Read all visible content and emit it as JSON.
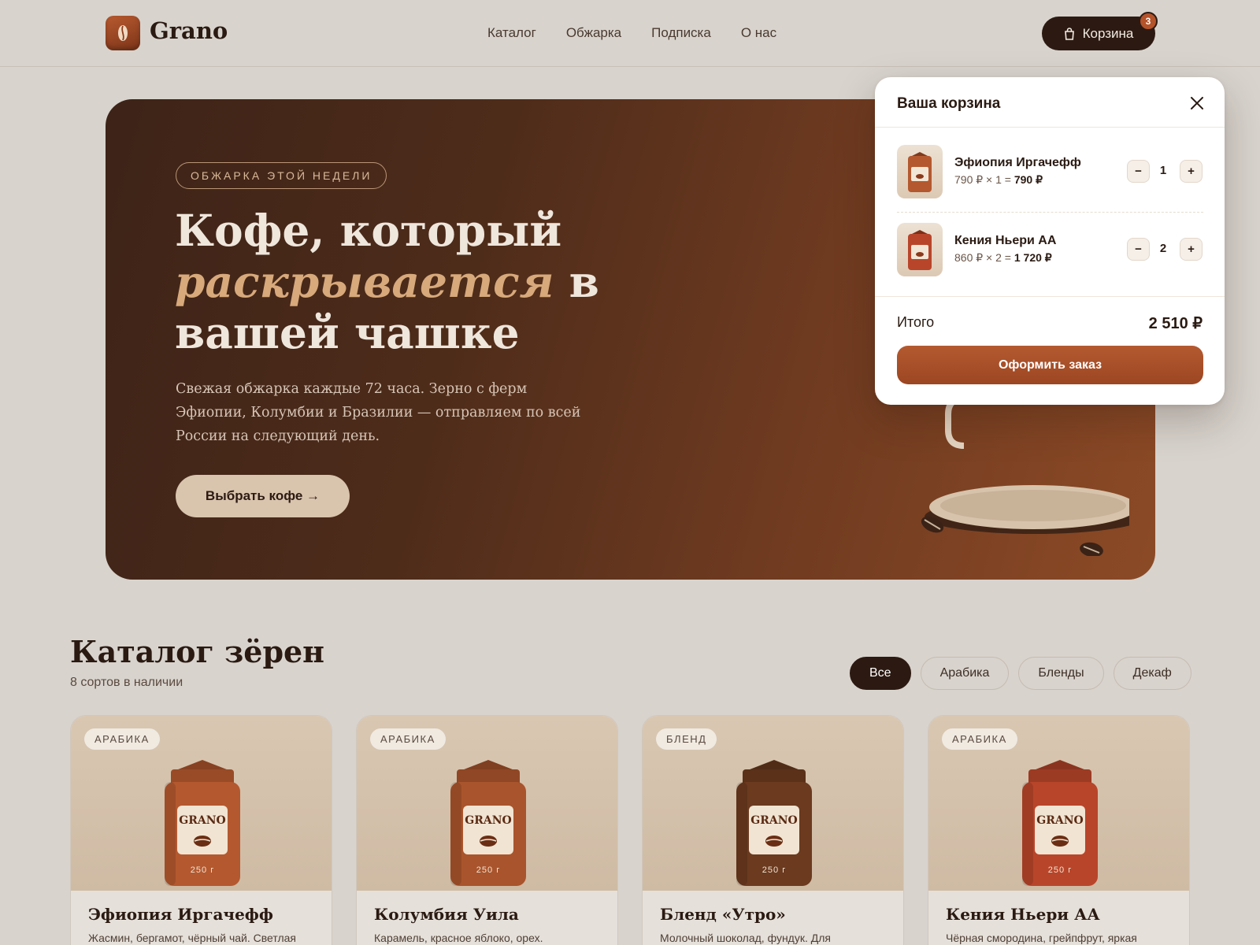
{
  "brand": {
    "name": "Grano"
  },
  "nav": {
    "items": [
      "Каталог",
      "Обжарка",
      "Подписка",
      "О нас"
    ]
  },
  "cart_button": {
    "label": "Корзина",
    "count": "3"
  },
  "hero": {
    "badge": "ОБЖАРКА ЭТОЙ НЕДЕЛИ",
    "title_line1": "Кофе, который",
    "title_accent": "раскрывается",
    "title_after_accent": " в",
    "title_line3": "вашей чашке",
    "description": "Свежая обжарка каждые 72 часа. Зерно с ферм Эфиопии, Колумбии и Бразилии — отправляем по всей России на следующий день.",
    "cta": "Выбрать кофе →"
  },
  "cart_popover": {
    "title": "Ваша корзина",
    "items": [
      {
        "name": "Эфиопия Иргачефф",
        "price_expr": "790 ₽ × 1 = ",
        "line_total": "790 ₽",
        "qty": "1"
      },
      {
        "name": "Кения Ньери АА",
        "price_expr": "860 ₽ × 2 = ",
        "line_total": "1 720 ₽",
        "qty": "2"
      }
    ],
    "total_label": "Итого",
    "total_value": "2 510 ₽",
    "order_button": "Оформить заказ"
  },
  "catalog": {
    "title": "Каталог зёрен",
    "subtitle": "8 сортов в наличии",
    "filters": [
      "Все",
      "Арабика",
      "Бленды",
      "Декаф"
    ],
    "active_filter": "Все",
    "products": [
      {
        "tag": "АРАБИКА",
        "name": "Эфиопия Иргачефф",
        "desc": "Жасмин, бергамот, чёрный чай. Светлая",
        "bag_brand": "GRANO",
        "weight": "250 г",
        "color": "#b4582f"
      },
      {
        "tag": "АРАБИКА",
        "name": "Колумбия Уила",
        "desc": "Карамель, красное яблоко, орех.",
        "bag_brand": "GRANO",
        "weight": "250 г",
        "color": "#a9542c"
      },
      {
        "tag": "БЛЕНД",
        "name": "Бленд «Утро»",
        "desc": "Молочный шоколад, фундук. Для",
        "bag_brand": "GRANO",
        "weight": "250 г",
        "color": "#6b3a1f"
      },
      {
        "tag": "АРАБИКА",
        "name": "Кения Ньери АА",
        "desc": "Чёрная смородина, грейпфрут, яркая",
        "bag_brand": "GRANO",
        "weight": "250 г",
        "color": "#b8452a"
      }
    ]
  },
  "icons": {
    "cart": "shopping-bag-icon",
    "close": "close-icon",
    "logo": "coffee-bean-icon"
  },
  "colors": {
    "accent": "#b5532a",
    "dark": "#2c1a12",
    "background": "#d8d3cd"
  }
}
